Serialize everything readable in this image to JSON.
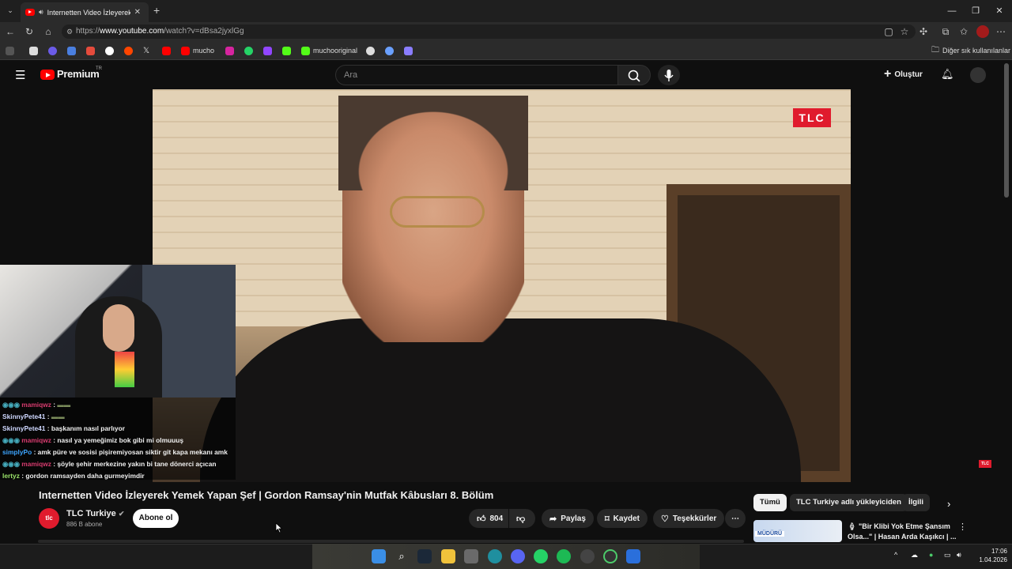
{
  "browser": {
    "tab_title": "Internetten Video İzleyerek Ye",
    "url_prefix": "https://",
    "url_domain": "www.youtube.com",
    "url_path": "/watch?v=dBsa2jyxlGg",
    "bookmarks": [
      "mucho",
      "muchooriginal"
    ],
    "other_bookmarks": "Diğer sık kullanılanlar"
  },
  "youtube": {
    "logo_text": "Premium",
    "region": "TR",
    "search_placeholder": "Ara",
    "create_label": "Oluştur"
  },
  "video": {
    "brand": "TLC",
    "title": "Internetten Video İzleyerek Yemek Yapan Şef | Gordon Ramsay'nin Mutfak Kâbusları 8. Bölüm"
  },
  "channel": {
    "avatar_text": "tlc",
    "name": "TLC Turkiye",
    "subscribers": "886 B abone",
    "subscribe_label": "Abone ol"
  },
  "actions": {
    "likes": "804",
    "share": "Paylaş",
    "save": "Kaydet",
    "thanks": "Teşekkürler"
  },
  "chips": [
    "Tümü",
    "TLC Turkiye adlı yükleyiciden",
    "İlgili"
  ],
  "related": {
    "thumb_text": "MÜDÜRÜ",
    "title": "\"Bir Klibi Yok Etme Şansım Olsa...\" | Hasan Arda Kaşıkcı | ..."
  },
  "chat": [
    {
      "user": "mamiqwz",
      "msg": ":",
      "color": "#d63b6e"
    },
    {
      "user": "SkinnyPete41",
      "msg": ":",
      "color": "#cfd8ff"
    },
    {
      "user": "SkinnyPete41",
      "msg": ": başkanım nasıl parlıyor",
      "color": "#cfd8ff"
    },
    {
      "user": "mamiqwz",
      "msg": ": nasıl ya yemeğimiz bok gibi mi olmuuuş",
      "color": "#d63b6e"
    },
    {
      "user": "simplyPo",
      "msg": ": amk püre ve sosisi pişiremiyosan siktir git kapa mekanı amk",
      "color": "#3da5ff"
    },
    {
      "user": "mamiqwz",
      "msg": ": şöyle şehir merkezine yakın bi tane dönerci açıcan",
      "color": "#d63b6e"
    },
    {
      "user": "lertyz",
      "msg": ": gordon ramsayden daha gurmeyimdir",
      "color": "#9be46a"
    }
  ],
  "system": {
    "time": "17:06",
    "date": "1.04.2026"
  },
  "colors": {
    "youtube_red": "#ff0000",
    "tlc_red": "#e01b2d",
    "bg": "#0f0f0f"
  }
}
